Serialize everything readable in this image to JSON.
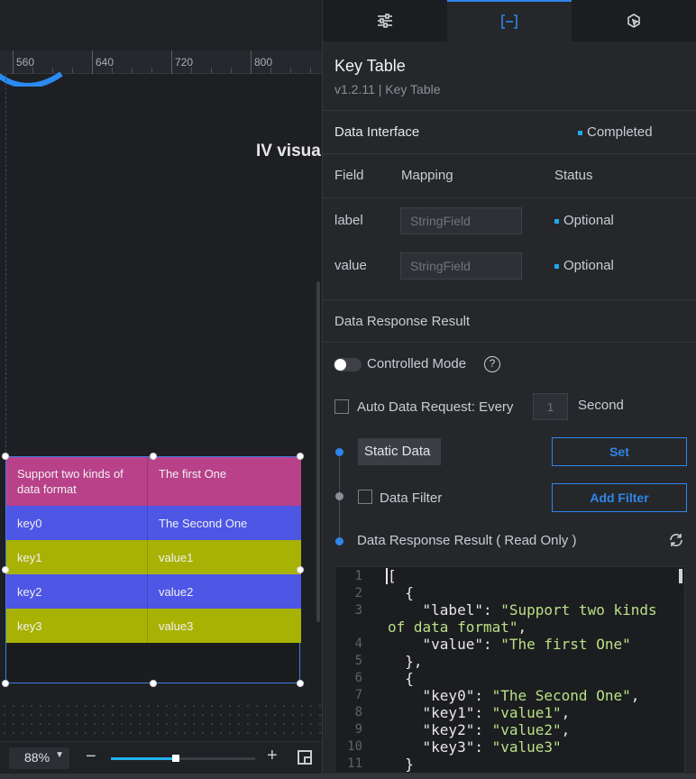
{
  "ruler": {
    "ticks": [
      "560",
      "640",
      "720",
      "800"
    ]
  },
  "canvas": {
    "visible_title_fragment": "IV visua",
    "table": {
      "rows": [
        {
          "key": "Support two kinds of data format",
          "value": "The first One",
          "color": "#b8418a"
        },
        {
          "key": "key0",
          "value": "The Second One",
          "color": "#4d56e5"
        },
        {
          "key": "key1",
          "value": "value1",
          "color": "#a8b204"
        },
        {
          "key": "key2",
          "value": "value2",
          "color": "#4d56e5"
        },
        {
          "key": "key3",
          "value": "value3",
          "color": "#a8b204"
        }
      ]
    }
  },
  "zoom": {
    "level": "88%",
    "slider_fraction": 0.45
  },
  "panel": {
    "tabs": [
      {
        "icon": "sliders-icon",
        "active": false
      },
      {
        "icon": "data-bracket-icon",
        "active": true
      },
      {
        "icon": "interaction-icon",
        "active": false
      }
    ],
    "title": "Key Table",
    "version": "v1.2.11 | Key Table",
    "data_interface": {
      "label": "Data Interface",
      "status": "Completed"
    },
    "fields_header": {
      "field": "Field",
      "mapping": "Mapping",
      "status": "Status"
    },
    "fields": [
      {
        "name": "label",
        "placeholder": "StringField",
        "status": "Optional"
      },
      {
        "name": "value",
        "placeholder": "StringField",
        "status": "Optional"
      }
    ],
    "response_section": "Data Response Result",
    "controlled_mode": "Controlled Mode",
    "auto_request": {
      "label": "Auto Data Request: Every",
      "interval": "1",
      "unit": "Second"
    },
    "static_data": "Static Data",
    "set_button": "Set",
    "data_filter": "Data Filter",
    "add_filter_button": "Add Filter",
    "readonly_label": "Data Response Result ( Read Only )",
    "accent": "#2f86e9",
    "code": {
      "line_numbers": [
        "1",
        "2",
        "3",
        "4",
        "5",
        "6",
        "7",
        "8",
        "9",
        "10",
        "11"
      ],
      "lines": [
        "[",
        "  {",
        "    \"label\": \"Support two kinds",
        "of data format\",",
        "    \"value\": \"The first One\"",
        "  },",
        "  {",
        "    \"key0\": \"The Second One\",",
        "    \"key1\": \"value1\",",
        "    \"key2\": \"value2\",",
        "    \"key3\": \"value3\"",
        "  }"
      ]
    }
  }
}
